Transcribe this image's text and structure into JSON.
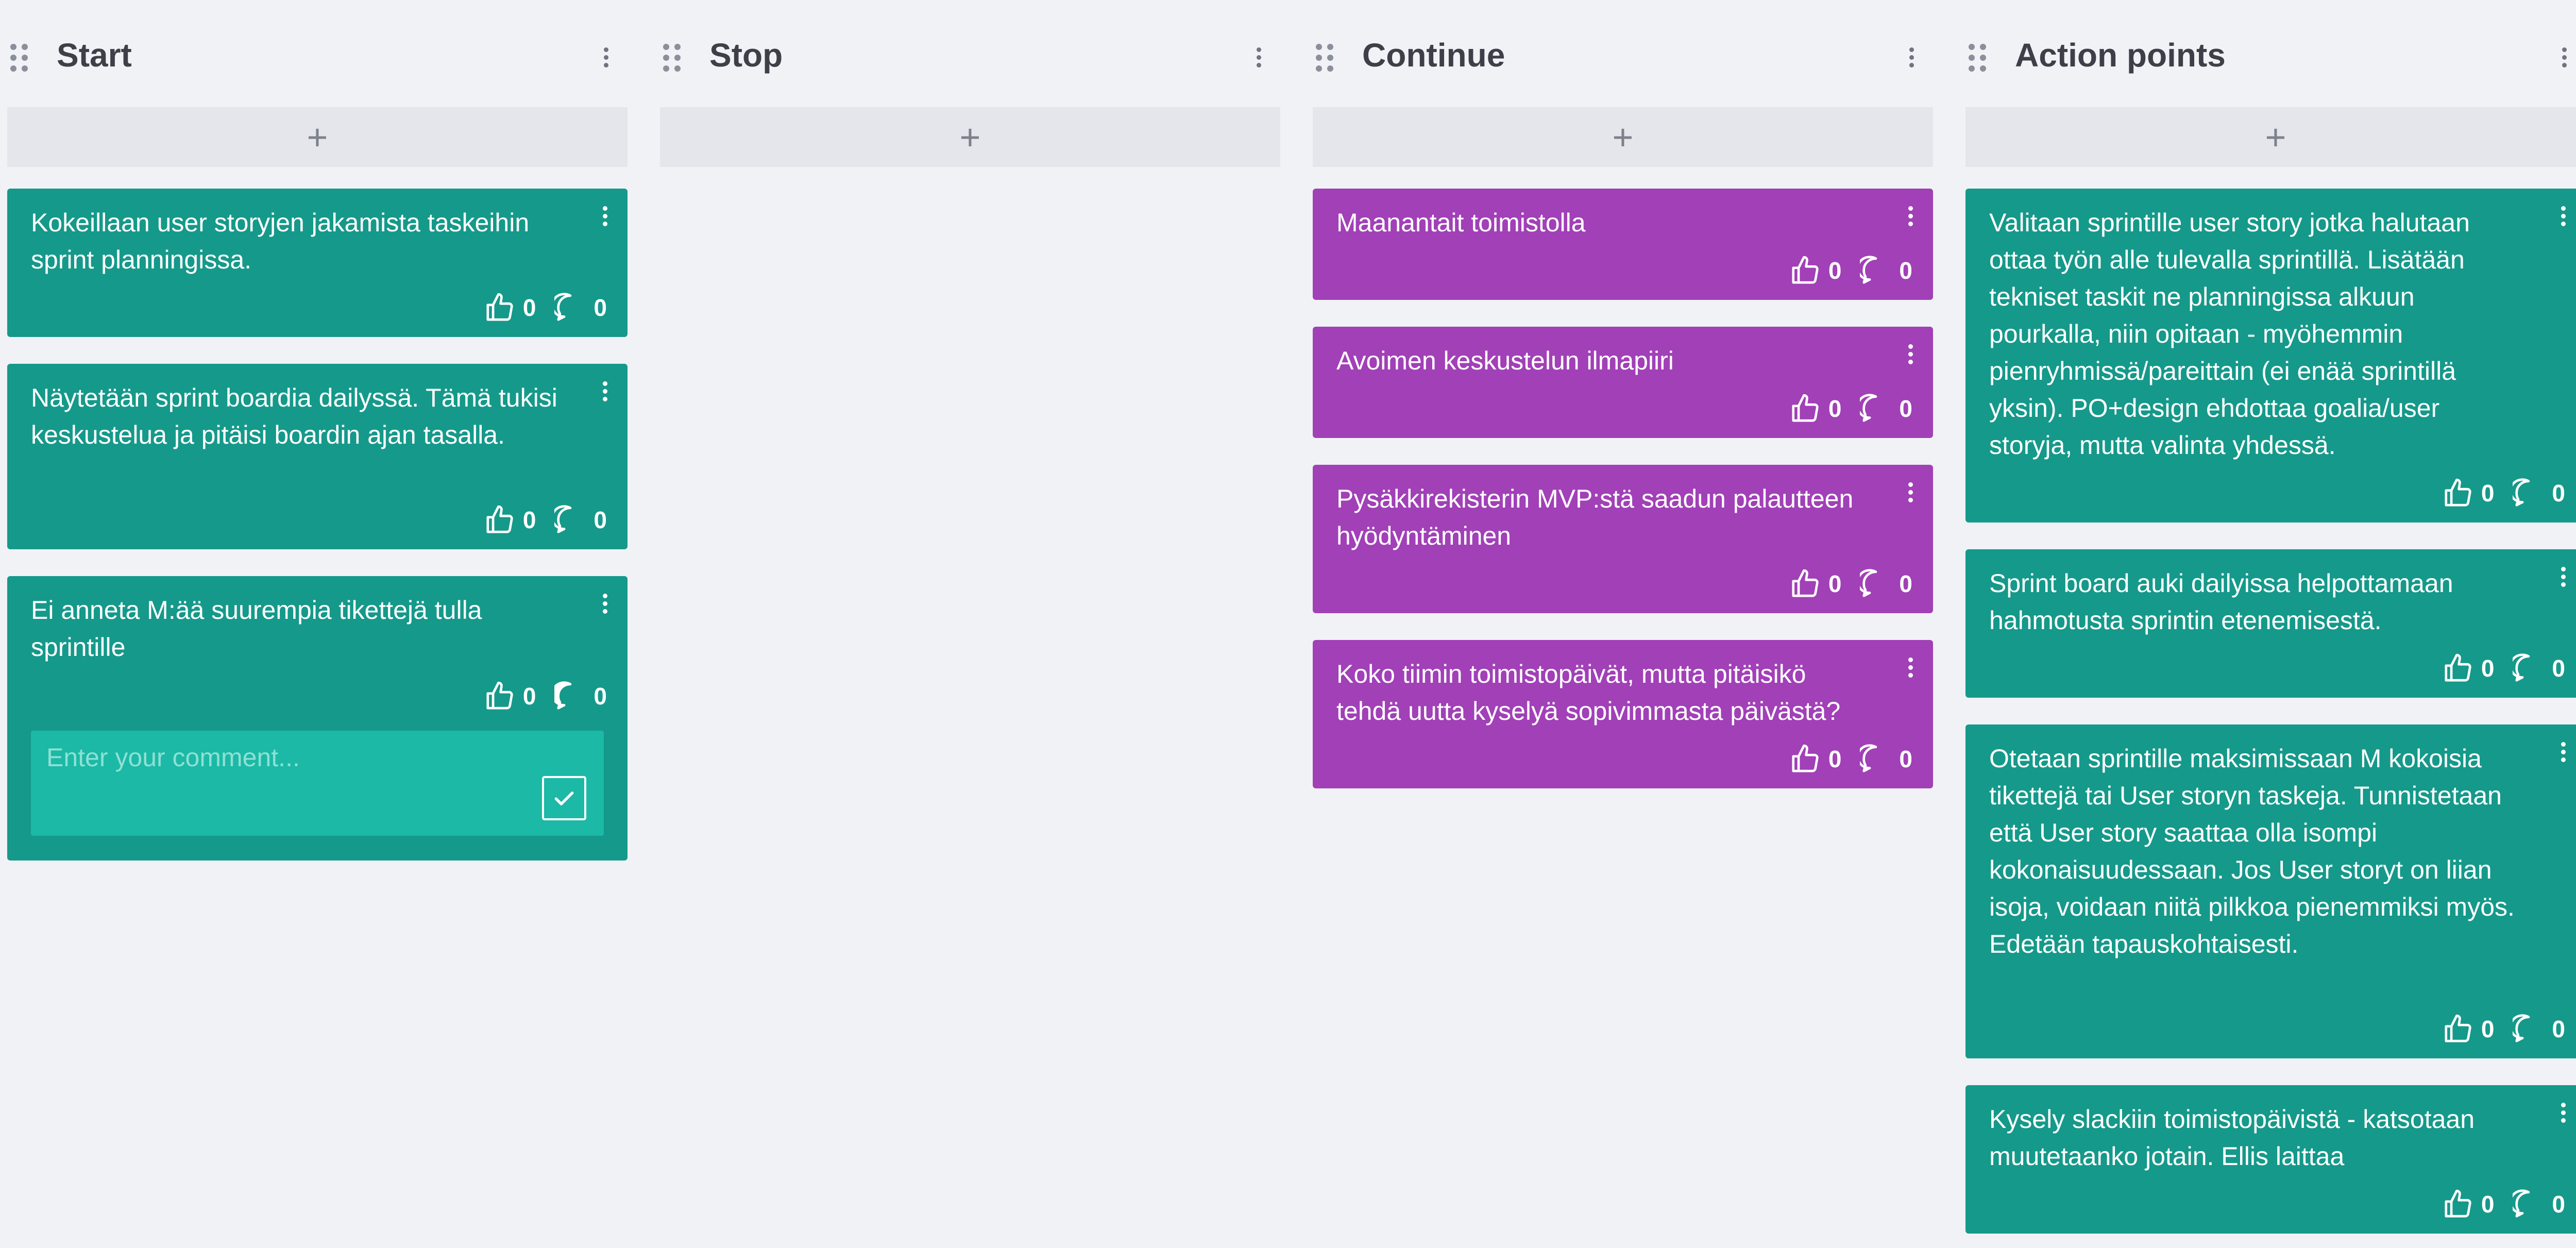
{
  "columns": [
    {
      "title": "Start",
      "add_label": "+",
      "cards": [
        {
          "text": "Kokeillaan user storyjen jakamista taskeihin sprint planningissa.",
          "likes": "0",
          "comments": "0"
        },
        {
          "text": "Näytetään sprint boardia dailyssä. Tämä tukisi keskustelua ja pitäisi boardin ajan tasalla.",
          "likes": "0",
          "comments": "0"
        },
        {
          "text": "Ei anneta M:ää suurempia tikettejä tulla sprintille",
          "likes": "0",
          "comments": "0",
          "comment_placeholder": "Enter your comment..."
        }
      ]
    },
    {
      "title": "Stop",
      "add_label": "+",
      "cards": []
    },
    {
      "title": "Continue",
      "add_label": "+",
      "cards": [
        {
          "text": "Maanantait toimistolla",
          "likes": "0",
          "comments": "0"
        },
        {
          "text": "Avoimen keskustelun ilmapiiri",
          "likes": "0",
          "comments": "0"
        },
        {
          "text": "Pysäkkirekisterin MVP:stä saadun palautteen hyödyntäminen",
          "likes": "0",
          "comments": "0"
        },
        {
          "text": "Koko tiimin toimistopäivät, mutta pitäisikö tehdä uutta kyselyä sopivimmasta päivästä?",
          "likes": "0",
          "comments": "0"
        }
      ]
    },
    {
      "title": "Action points",
      "add_label": "+",
      "cards": [
        {
          "text": "Valitaan sprintille user story jotka halutaan ottaa työn alle tulevalla sprintillä. Lisätään tekniset taskit ne planningissa alkuun pourkalla, niin opitaan - myöhemmin pienryhmissä/pareittain (ei enää sprintillä yksin). PO+design ehdottaa goalia/user storyja, mutta valinta yhdessä.",
          "likes": "0",
          "comments": "0"
        },
        {
          "text": "Sprint board auki dailyissa helpottamaan hahmotusta sprintin etenemisestä.",
          "likes": "0",
          "comments": "0"
        },
        {
          "text": "Otetaan sprintille maksimissaan M kokoisia tikettejä tai User storyn taskeja. Tunnistetaan että User story saattaa olla isompi kokonaisuudessaan. Jos User storyt on liian isoja, voidaan niitä pilkkoa pienemmiksi myös. Edetään tapauskohtaisesti.",
          "likes": "0",
          "comments": "0"
        },
        {
          "text": "Kysely slackiin toimistopäivistä - katsotaan muutetaanko jotain. Ellis laittaa",
          "likes": "0",
          "comments": "0"
        }
      ]
    }
  ],
  "colors": {
    "background": "#f1f2f6",
    "green_card": "#15998a",
    "purple_card": "#a140b7",
    "add_bar": "#e4e6eb",
    "comment_box": "#1bb9a6"
  },
  "icons": {
    "like": "thumbs-up-icon",
    "comment": "comment-bubble-icon",
    "menu": "vertical-dots-icon",
    "drag": "drag-handle-icon",
    "submit": "checkmark-icon"
  }
}
